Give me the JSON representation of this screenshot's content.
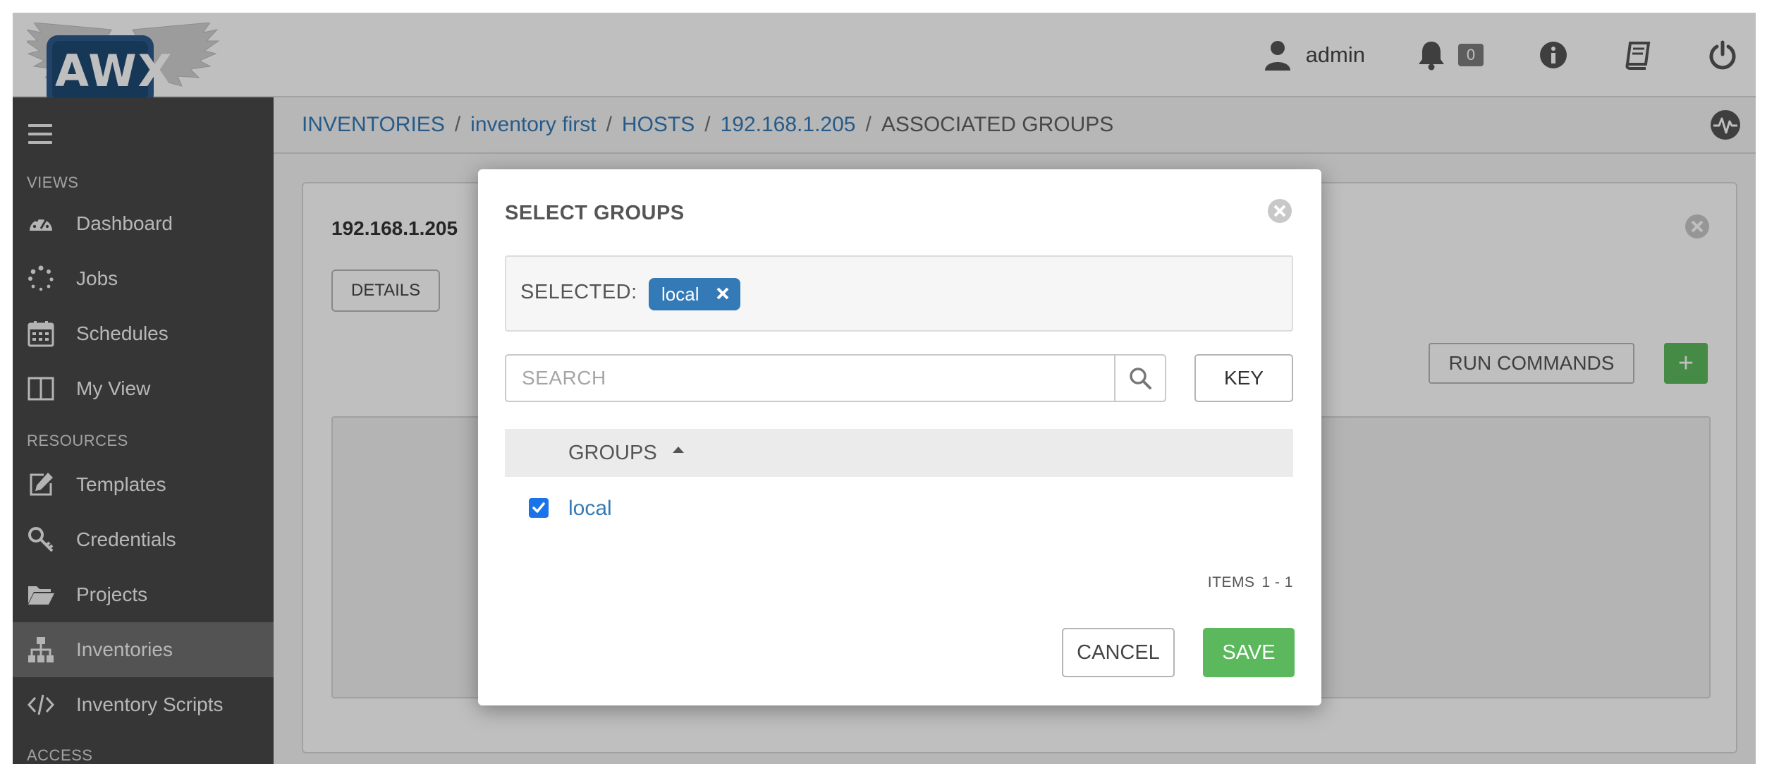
{
  "colors": {
    "link": "#337ab7",
    "sidebar_bg": "#484848",
    "sidebar_active": "#6f6f6f",
    "success": "#5cb85c",
    "chip": "#337ab7",
    "badge": "#7d7d7d"
  },
  "header": {
    "logo_text": "AWX",
    "user_name": "admin",
    "notification_count": "0",
    "icons": [
      "user-icon",
      "bell-icon",
      "info-icon",
      "book-icon",
      "power-icon"
    ]
  },
  "sidebar": {
    "sections": {
      "views": "VIEWS",
      "resources": "RESOURCES",
      "access": "ACCESS"
    },
    "items": [
      {
        "label": "Dashboard",
        "icon": "dashboard-icon"
      },
      {
        "label": "Jobs",
        "icon": "jobs-spinner-icon"
      },
      {
        "label": "Schedules",
        "icon": "calendar-icon"
      },
      {
        "label": "My View",
        "icon": "columns-icon"
      },
      {
        "label": "Templates",
        "icon": "edit-icon"
      },
      {
        "label": "Credentials",
        "icon": "key-icon"
      },
      {
        "label": "Projects",
        "icon": "folder-icon"
      },
      {
        "label": "Inventories",
        "icon": "sitemap-icon",
        "active": true
      },
      {
        "label": "Inventory Scripts",
        "icon": "code-icon"
      }
    ]
  },
  "breadcrumb": {
    "items": [
      "INVENTORIES",
      "inventory first",
      "HOSTS",
      "192.168.1.205"
    ],
    "current": "ASSOCIATED GROUPS",
    "separator": "/"
  },
  "panel": {
    "title": "192.168.1.205",
    "details_label": "DETAILS",
    "run_commands_label": "RUN COMMANDS",
    "add_label": "+"
  },
  "modal": {
    "title": "SELECT GROUPS",
    "selected_label": "SELECTED:",
    "selected_chips": [
      "local"
    ],
    "search_placeholder": "SEARCH",
    "key_label": "KEY",
    "table": {
      "column_header": "GROUPS",
      "rows": [
        {
          "name": "local",
          "checked": true
        }
      ]
    },
    "items_label": "ITEMS",
    "items_range": "1 - 1",
    "cancel_label": "CANCEL",
    "save_label": "SAVE"
  }
}
